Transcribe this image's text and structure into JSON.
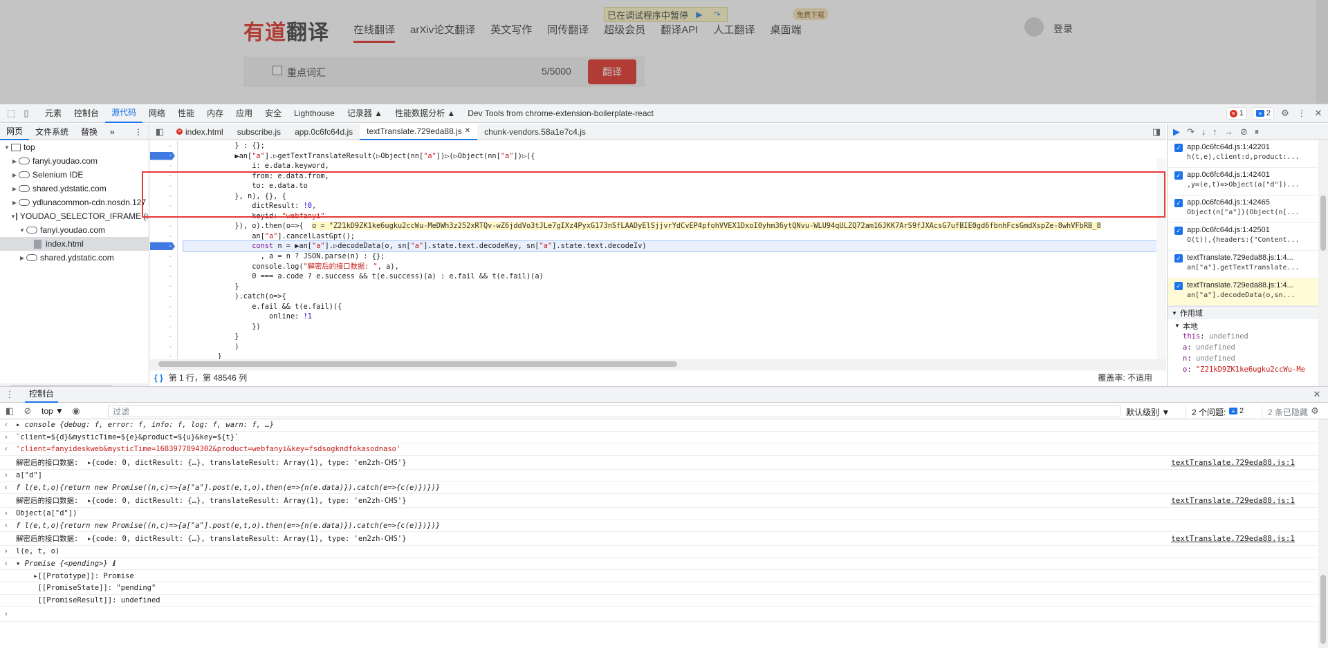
{
  "site": {
    "logo_red": "有道",
    "logo_dark": "翻译",
    "nav": [
      "在线翻译",
      "arXiv论文翻译",
      "英文写作",
      "同传翻译",
      "超级会员",
      "翻译API",
      "人工翻译",
      "桌面端"
    ],
    "paused_text": "已在调试程序中暂停",
    "free_download": "免费下载",
    "login": "登录",
    "keyword_label": "重点词汇",
    "char_count": "5/5000",
    "translate_button": "翻译"
  },
  "devtools": {
    "panels": [
      "元素",
      "控制台",
      "源代码",
      "网络",
      "性能",
      "内存",
      "应用",
      "安全",
      "Lighthouse",
      "记录器 ▲",
      "性能数据分析 ▲",
      "Dev Tools from chrome-extension-boilerplate-react"
    ],
    "active_panel": "源代码",
    "error_count": "1",
    "message_count": "2",
    "navigator_tabs": [
      "网页",
      "文件系统",
      "替换",
      "»"
    ],
    "tree": [
      {
        "label": "top",
        "indent": 0,
        "kind": "frame",
        "open": true
      },
      {
        "label": "fanyi.youdao.com",
        "indent": 1,
        "kind": "cloud",
        "open": false
      },
      {
        "label": "Selenium IDE",
        "indent": 1,
        "kind": "cloud",
        "open": false
      },
      {
        "label": "shared.ydstatic.com",
        "indent": 1,
        "kind": "cloud",
        "open": false
      },
      {
        "label": "ydlunacommon-cdn.nosdn.127",
        "indent": 1,
        "kind": "cloud",
        "open": false
      },
      {
        "label": "YOUDAO_SELECTOR_IFRAME (in",
        "indent": 1,
        "kind": "frame",
        "open": true
      },
      {
        "label": "fanyi.youdao.com",
        "indent": 2,
        "kind": "cloud",
        "open": true
      },
      {
        "label": "index.html",
        "indent": 3,
        "kind": "file",
        "open": null
      },
      {
        "label": "shared.ydstatic.com",
        "indent": 2,
        "kind": "cloud",
        "open": false
      }
    ],
    "file_tabs": [
      "index.html",
      "subscribe.js",
      "app.0c6fc64d.js",
      "textTranslate.729eda88.js",
      "chunk-vendors.58a1e7c4.js"
    ],
    "active_file_tab": "textTranslate.729eda88.js",
    "code_lines": [
      "            } : {};",
      "            ▶an[\"a\"].▷getTextTranslateResult(▷Object(nn[\"a\"])▷(▷Object(nn[\"a\"])▷({",
      "                i: e.data.keyword,",
      "                from: e.data.from,",
      "                to: e.data.to",
      "            }, n), {}, {",
      "                dictResult: !0,",
      "                keyid: \"webfanyi\"",
      "            }), o).then(o=>{  o = \"Z21kD9ZK1ke6ugku2ccWu-MeDWh3z252xRTQv-wZ6jddVo3tJLe7gIXz4PyxG173nSfLAADyElSjjvrYdCvEP4pfohVVEX1DxoI0yhm36ytQNvu-WLU94qULZQ72am16JKK7ArS9fJXAcsG7ufBIE0gd6fbnhFcsGmdXspZe-8whVFbRB_8",
      "                an[\"a\"].cancelLastGpt();",
      "                const n = ▶an[\"a\"].▷decodeData(o, sn[\"a\"].state.text.decodeKey, sn[\"a\"].state.text.decodeIv)",
      "                  , a = n ? JSON.parse(n) : {};",
      "                console.log(\"解密后的接口数据: \", a),",
      "                0 === a.code ? e.success && t(e.success)(a) : e.fail && t(e.fail)(a)",
      "            }",
      "            ).catch(o=>{",
      "                e.fail && t(e.fail)({",
      "                    online: !1",
      "                })",
      "            }",
      "            )",
      "        }"
    ],
    "gutter_mark": "-",
    "breakpoint_lines": [
      1,
      10
    ],
    "exec_line": 10,
    "status_position": "第 1 行，第 48546 列",
    "coverage": "覆盖率: 不适用",
    "call_stack": [
      {
        "loc": "app.0c6fc64d.js:1:42201",
        "code": "h(t,e),client:d,product:..."
      },
      {
        "loc": "app.0c6fc64d.js:1:42401",
        "code": ",y=(e,t)=>Object(a[\"d\"])..."
      },
      {
        "loc": "app.0c6fc64d.js:1:42465",
        "code": "Object(n[\"a\"])(Object(n[..."
      },
      {
        "loc": "app.0c6fc64d.js:1:42501",
        "code": "O(t)),{headers:{\"Content..."
      },
      {
        "loc": "textTranslate.729eda88.js:1:4...",
        "code": "an[\"a\"].getTextTranslate..."
      },
      {
        "loc": "textTranslate.729eda88.js:1:4...",
        "code": "an[\"a\"].decodeData(o,sn..."
      }
    ],
    "scope_header": "作用域",
    "scope_local": "本地",
    "scope_vars": [
      {
        "k": "this",
        "v": "undefined",
        "t": "u"
      },
      {
        "k": "a",
        "v": "undefined",
        "t": "u"
      },
      {
        "k": "n",
        "v": "undefined",
        "t": "u"
      },
      {
        "k": "o",
        "v": "\"Z21kD9ZK1ke6ugku2ccWu-Me",
        "t": "s"
      }
    ],
    "drawer_title": "控制台",
    "console_context": "top ▼",
    "filter_placeholder": "过滤",
    "log_level": "默认级别 ▼",
    "issues_label": "2 个问题:",
    "issues_count": "2",
    "hidden_label": "2 条已隐藏",
    "console_rows": [
      {
        "pfx": "‹",
        "text": "▸ console {debug: f, error: f, info: f, log: f, warn: f, …}",
        "cls": "it",
        "src": ""
      },
      {
        "pfx": "›",
        "text": "`client=${d}&mysticTime=${e}&product=${u}&key=${t}`",
        "cls": "",
        "src": ""
      },
      {
        "pfx": "‹",
        "text": "'client=fanyideskweb&mysticTime=1683977894302&product=webfanyi&key=fsdsogkndfokasodnaso'",
        "cls": "o-str",
        "src": ""
      },
      {
        "pfx": "",
        "text": "解密后的接口数据:  ▸{code: 0, dictResult: {…}, translateResult: Array(1), type: 'en2zh-CHS'}",
        "cls": "",
        "src": "textTranslate.729eda88.js:1"
      },
      {
        "pfx": "›",
        "text": "a[\"d\"]",
        "cls": "",
        "src": ""
      },
      {
        "pfx": "‹",
        "text": "f l(e,t,o){return new Promise((n,c)=>{a[\"a\"].post(e,t,o).then(e=>{n(e.data)}).catch(e=>{c(e)})})}",
        "cls": "it",
        "src": ""
      },
      {
        "pfx": "",
        "text": "解密后的接口数据:  ▸{code: 0, dictResult: {…}, translateResult: Array(1), type: 'en2zh-CHS'}",
        "cls": "",
        "src": "textTranslate.729eda88.js:1"
      },
      {
        "pfx": "›",
        "text": "Object(a[\"d\"])",
        "cls": "",
        "src": ""
      },
      {
        "pfx": "‹",
        "text": "f l(e,t,o){return new Promise((n,c)=>{a[\"a\"].post(e,t,o).then(e=>{n(e.data)}).catch(e=>{c(e)})})}",
        "cls": "it",
        "src": ""
      },
      {
        "pfx": "",
        "text": "解密后的接口数据:  ▸{code: 0, dictResult: {…}, translateResult: Array(1), type: 'en2zh-CHS'}",
        "cls": "",
        "src": "textTranslate.729eda88.js:1"
      },
      {
        "pfx": "›",
        "text": "l(e, t, o)",
        "cls": "",
        "src": ""
      },
      {
        "pfx": "‹",
        "text": "▾ Promise {<pending>} ℹ",
        "cls": "it",
        "src": ""
      },
      {
        "pfx": "",
        "text": "    ▸[[Prototype]]: Promise",
        "cls": "",
        "src": ""
      },
      {
        "pfx": "",
        "text": "     [[PromiseState]]: \"pending\"",
        "cls": "",
        "src": ""
      },
      {
        "pfx": "",
        "text": "     [[PromiseResult]]: undefined",
        "cls": "",
        "src": ""
      },
      {
        "pfx": "›",
        "text": "",
        "cls": "",
        "src": ""
      }
    ]
  }
}
